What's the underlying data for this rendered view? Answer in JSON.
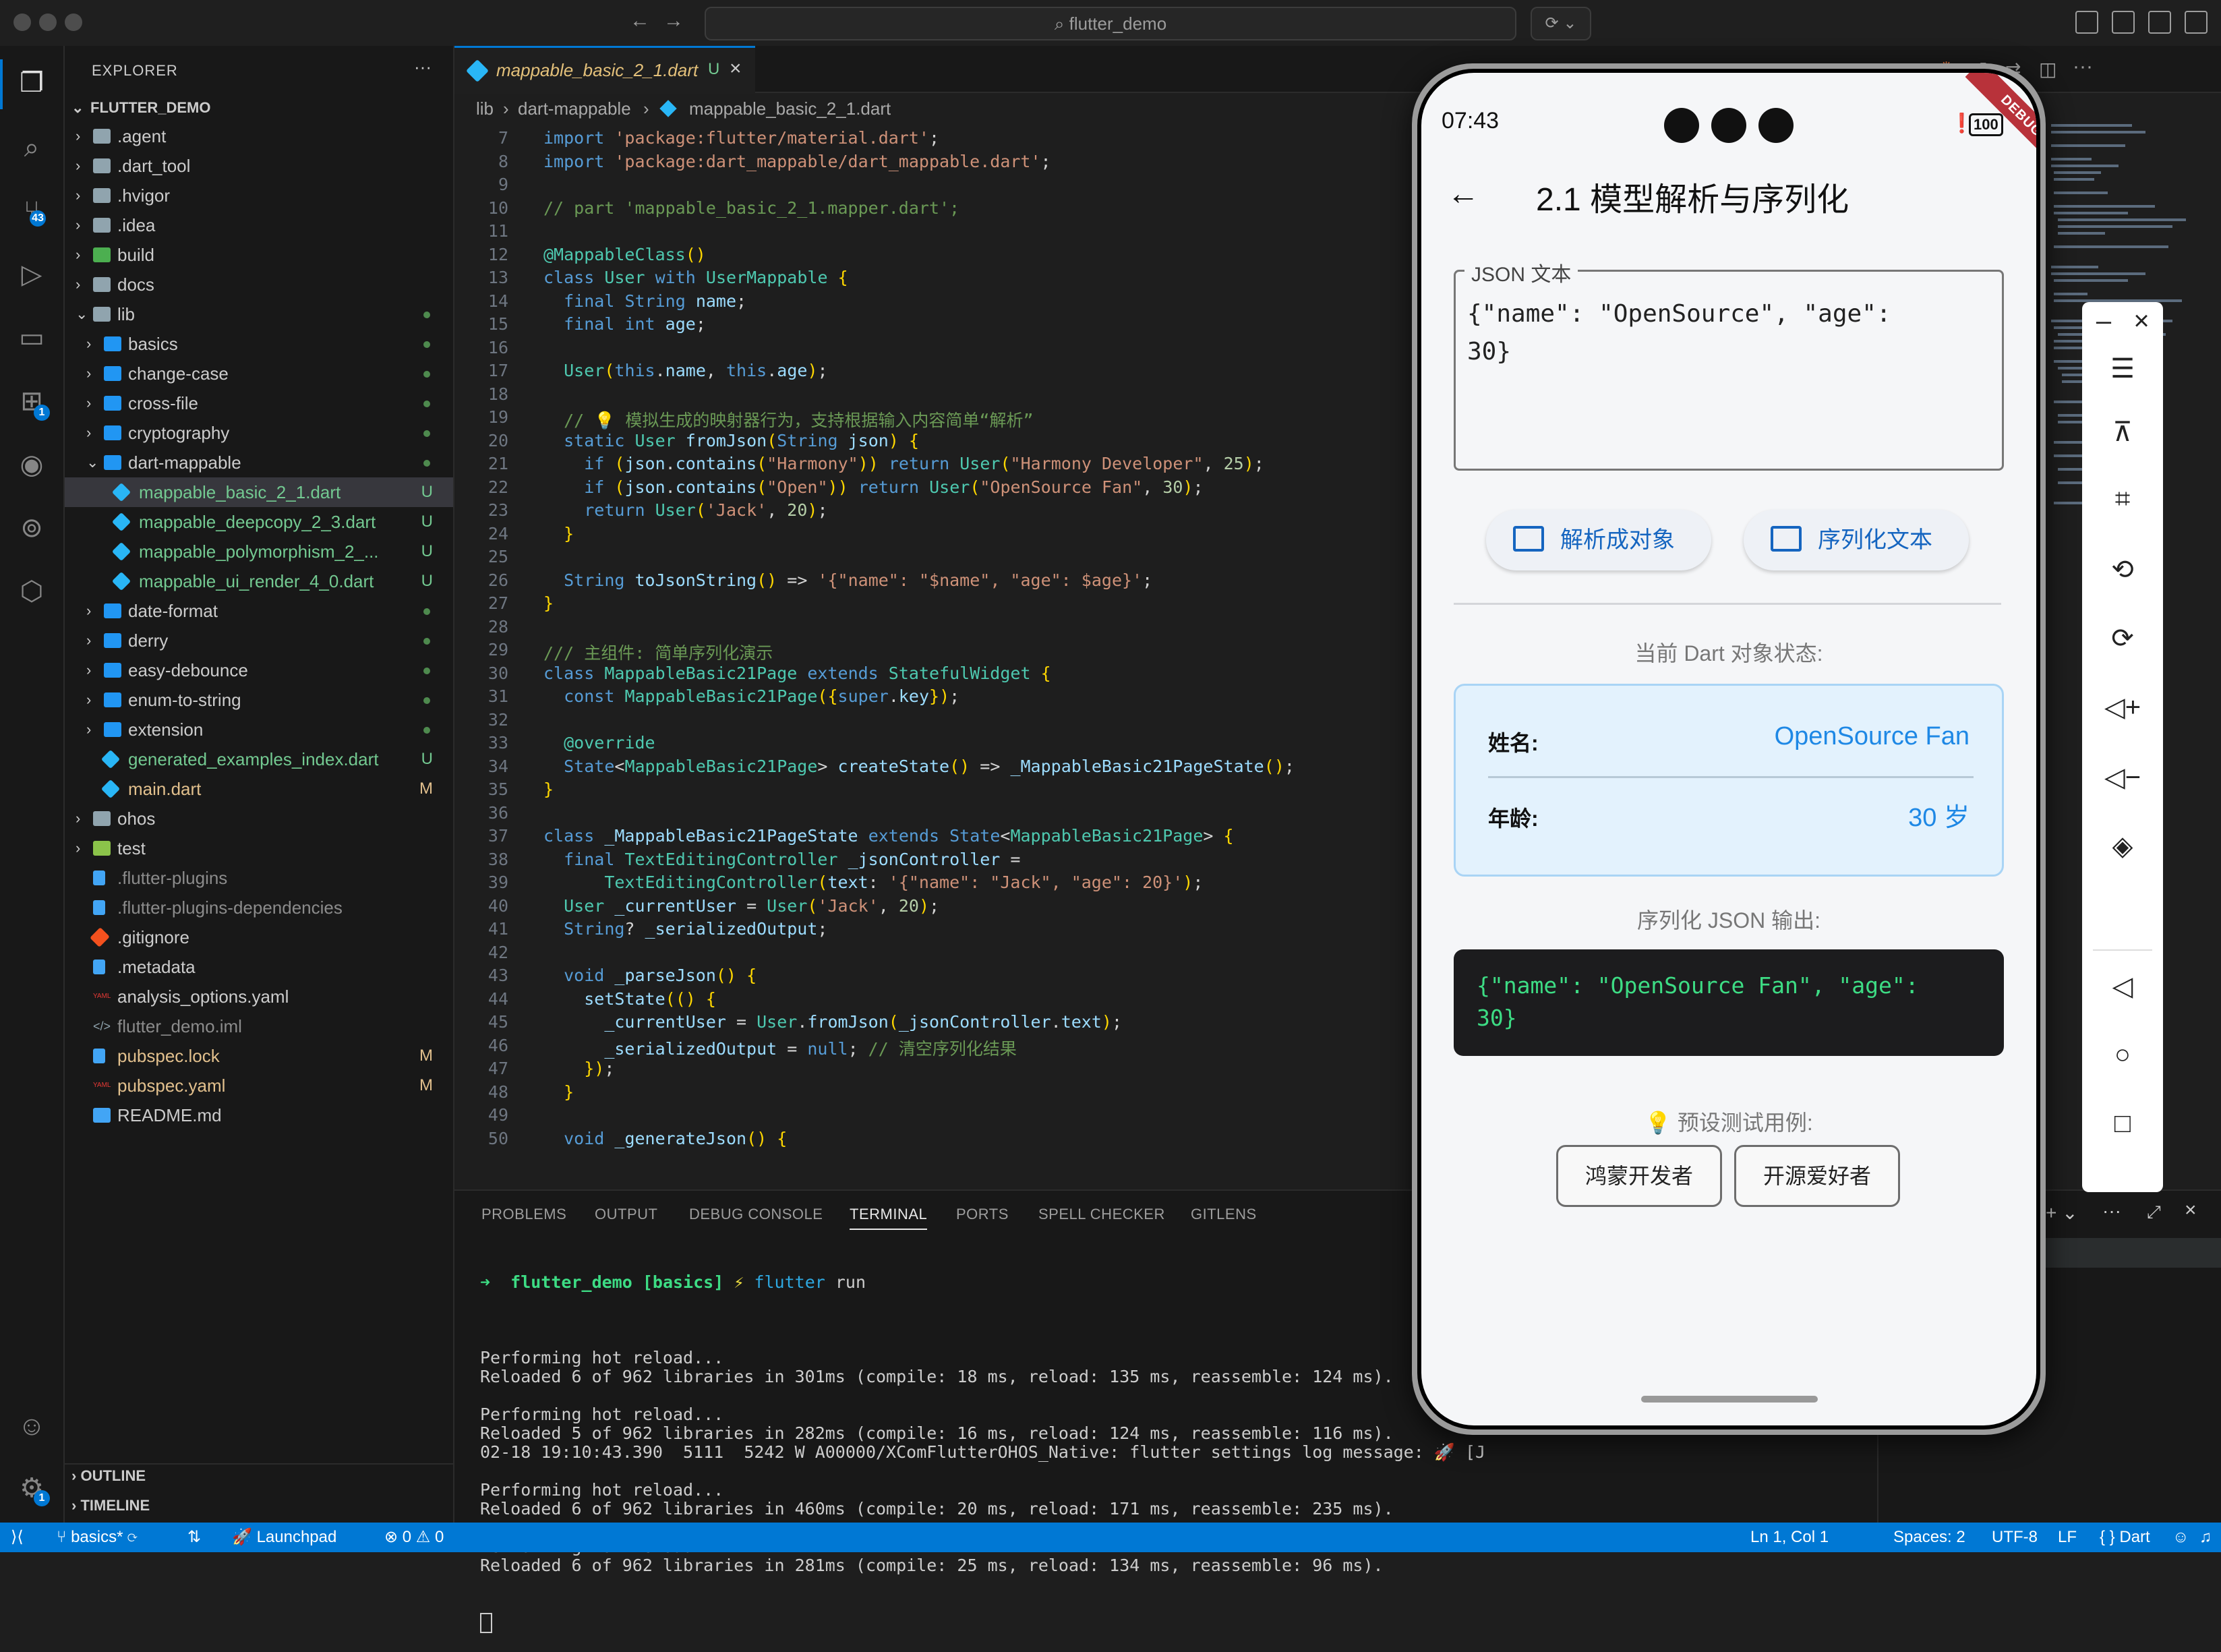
{
  "window": {
    "search_text": "flutter_demo"
  },
  "sidebar": {
    "title": "EXPLORER",
    "project": "FLUTTER_DEMO",
    "items": [
      {
        "label": ".agent",
        "type": "folder"
      },
      {
        "label": ".dart_tool",
        "type": "folder"
      },
      {
        "label": ".hvigor",
        "type": "folder"
      },
      {
        "label": ".idea",
        "type": "folder"
      },
      {
        "label": "build",
        "type": "folder"
      },
      {
        "label": "docs",
        "type": "folder"
      },
      {
        "label": "lib",
        "type": "folder"
      },
      {
        "label": "basics",
        "type": "folder"
      },
      {
        "label": "change-case",
        "type": "folder"
      },
      {
        "label": "cross-file",
        "type": "folder"
      },
      {
        "label": "cryptography",
        "type": "folder"
      },
      {
        "label": "dart-mappable",
        "type": "folder"
      },
      {
        "label": "mappable_basic_2_1.dart",
        "status": "U"
      },
      {
        "label": "mappable_deepcopy_2_3.dart",
        "status": "U"
      },
      {
        "label": "mappable_polymorphism_2_...",
        "status": "U"
      },
      {
        "label": "mappable_ui_render_4_0.dart",
        "status": "U"
      },
      {
        "label": "date-format",
        "type": "folder"
      },
      {
        "label": "derry",
        "type": "folder"
      },
      {
        "label": "easy-debounce",
        "type": "folder"
      },
      {
        "label": "enum-to-string",
        "type": "folder"
      },
      {
        "label": "extension",
        "type": "folder"
      },
      {
        "label": "generated_examples_index.dart",
        "status": "U"
      },
      {
        "label": "main.dart",
        "status": "M"
      },
      {
        "label": "ohos",
        "type": "folder"
      },
      {
        "label": "test",
        "type": "folder"
      },
      {
        "label": ".flutter-plugins"
      },
      {
        "label": ".flutter-plugins-dependencies"
      },
      {
        "label": ".gitignore"
      },
      {
        "label": ".metadata"
      },
      {
        "label": "analysis_options.yaml"
      },
      {
        "label": "flutter_demo.iml"
      },
      {
        "label": "pubspec.lock",
        "status": "M"
      },
      {
        "label": "pubspec.yaml",
        "status": "M"
      },
      {
        "label": "README.md"
      }
    ],
    "outline": "OUTLINE",
    "timeline": "TIMELINE"
  },
  "activity": {
    "scm_badge": "43",
    "ext_badge": "1",
    "settings_badge": "1"
  },
  "editor": {
    "tab_label": "mappable_basic_2_1.dart",
    "tab_status": "U",
    "breadcrumb": [
      "lib",
      "dart-mappable",
      "mappable_basic_2_1.dart"
    ],
    "lines": [
      {
        "n": "7",
        "t": "import 'package:flutter/material.dart';"
      },
      {
        "n": "8",
        "t": "import 'package:dart_mappable/dart_mappable.dart';"
      },
      {
        "n": "9",
        "t": ""
      },
      {
        "n": "10",
        "t": "// part 'mappable_basic_2_1.mapper.dart';"
      },
      {
        "n": "11",
        "t": ""
      },
      {
        "n": "12",
        "t": "@MappableClass()"
      },
      {
        "n": "13",
        "t": "class User with UserMappable {"
      },
      {
        "n": "14",
        "t": "  final String name;"
      },
      {
        "n": "15",
        "t": "  final int age;"
      },
      {
        "n": "16",
        "t": ""
      },
      {
        "n": "17",
        "t": "  User(this.name, this.age);"
      },
      {
        "n": "18",
        "t": ""
      },
      {
        "n": "19",
        "t": "  // 💡 模拟生成的映射器行为，支持根据输入内容简单“解析”"
      },
      {
        "n": "20",
        "t": "  static User fromJson(String json) {"
      },
      {
        "n": "21",
        "t": "    if (json.contains(\"Harmony\")) return User(\"Harmony Developer\", 25);"
      },
      {
        "n": "22",
        "t": "    if (json.contains(\"Open\")) return User(\"OpenSource Fan\", 30);"
      },
      {
        "n": "23",
        "t": "    return User('Jack', 20);"
      },
      {
        "n": "24",
        "t": "  }"
      },
      {
        "n": "25",
        "t": ""
      },
      {
        "n": "26",
        "t": "  String toJsonString() => '{\"name\": \"$name\", \"age\": $age}';"
      },
      {
        "n": "27",
        "t": "}"
      },
      {
        "n": "28",
        "t": ""
      },
      {
        "n": "29",
        "t": "/// 主组件: 简单序列化演示"
      },
      {
        "n": "30",
        "t": "class MappableBasic21Page extends StatefulWidget {"
      },
      {
        "n": "31",
        "t": "  const MappableBasic21Page({super.key});"
      },
      {
        "n": "32",
        "t": ""
      },
      {
        "n": "33",
        "t": "  @override"
      },
      {
        "n": "34",
        "t": "  State<MappableBasic21Page> createState() => _MappableBasic21PageState();"
      },
      {
        "n": "35",
        "t": "}"
      },
      {
        "n": "36",
        "t": ""
      },
      {
        "n": "37",
        "t": "class _MappableBasic21PageState extends State<MappableBasic21Page> {"
      },
      {
        "n": "38",
        "t": "  final TextEditingController _jsonController ="
      },
      {
        "n": "39",
        "t": "      TextEditingController(text: '{\"name\": \"Jack\", \"age\": 20}');"
      },
      {
        "n": "40",
        "t": "  User _currentUser = User('Jack', 20);"
      },
      {
        "n": "41",
        "t": "  String? _serializedOutput;"
      },
      {
        "n": "42",
        "t": ""
      },
      {
        "n": "43",
        "t": "  void _parseJson() {"
      },
      {
        "n": "44",
        "t": "    setState(() {"
      },
      {
        "n": "45",
        "t": "      _currentUser = User.fromJson(_jsonController.text);"
      },
      {
        "n": "46",
        "t": "      _serializedOutput = null; // 清空序列化结果"
      },
      {
        "n": "47",
        "t": "    });"
      },
      {
        "n": "48",
        "t": "  }"
      },
      {
        "n": "49",
        "t": ""
      },
      {
        "n": "50",
        "t": "  void _generateJson() {"
      }
    ]
  },
  "panel": {
    "tabs": [
      "PROBLEMS",
      "OUTPUT",
      "DEBUG CONSOLE",
      "TERMINAL",
      "PORTS",
      "SPELL CHECKER",
      "GITLENS"
    ],
    "prompt_dir": "flutter_demo",
    "prompt_branch": "[basics]",
    "prompt_cmd": "flutter",
    "prompt_arg": "run",
    "output": [
      "",
      "Performing hot reload...",
      "Reloaded 6 of 962 libraries in 301ms (compile: 18 ms, reload: 135 ms, reassemble: 124 ms).",
      "",
      "Performing hot reload...",
      "Reloaded 5 of 962 libraries in 282ms (compile: 16 ms, reload: 124 ms, reassemble: 116 ms).",
      "02-18 19:10:43.390  5111  5242 W A00000/XComFlutterOHOS_Native: flutter settings log message: 🚀 [J",
      "",
      "Performing hot reload...",
      "Reloaded 6 of 962 libraries in 460ms (compile: 20 ms, reload: 171 ms, reassemble: 235 ms).",
      "",
      "Performing hot reload...",
      "Reloaded 6 of 962 libraries in 281ms (compile: 25 ms, reload: 134 ms, reassemble: 96 ms)."
    ]
  },
  "statusbar": {
    "branch": "basics*",
    "launchpad": "Launchpad",
    "errors": "0",
    "warnings": "0",
    "position": "Ln 1, Col 1",
    "spaces": "Spaces: 2",
    "encoding": "UTF-8",
    "eol": "LF",
    "language": "Dart"
  },
  "phone": {
    "time": "07:43",
    "battery": "100",
    "debug_banner": "DEBUG",
    "app_title": "2.1 模型解析与序列化",
    "json_label": "JSON 文本",
    "json_text": "{\"name\": \"OpenSource\", \"age\":\n30}",
    "parse_button": "解析成对象",
    "serialize_button": "序列化文本",
    "state_label": "当前 Dart 对象状态:",
    "name_label": "姓名:",
    "name_value": "OpenSource Fan",
    "age_label": "年龄:",
    "age_value": "30 岁",
    "output_label": "序列化 JSON 输出:",
    "output_text": "{\"name\": \"OpenSource Fan\", \"age\":\n30}",
    "preset_label": "预设测试用例:",
    "preset_1": "鸿蒙开发者",
    "preset_2": "开源爱好者"
  },
  "colors": {
    "accent": "#0078d4",
    "sidebar_bg": "#181818",
    "editor_bg": "#1e1e1e",
    "link_blue": "#1976d2",
    "output_green": "#3ddc84"
  }
}
